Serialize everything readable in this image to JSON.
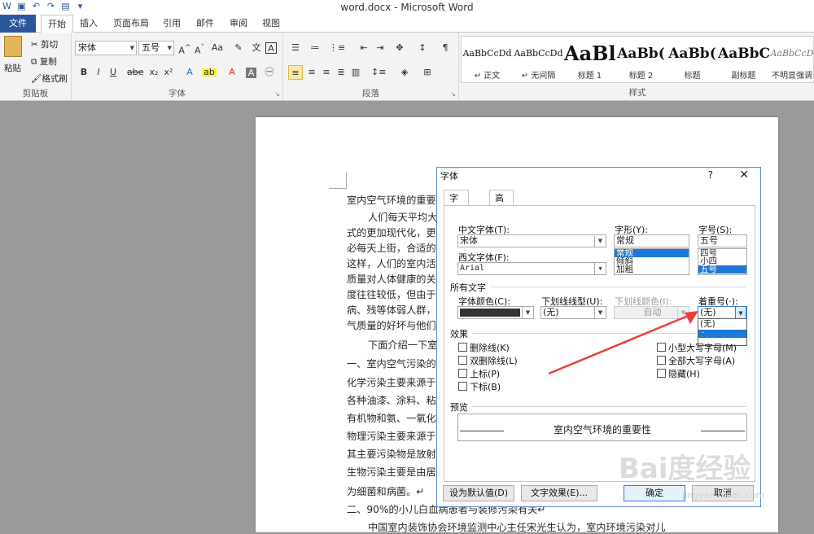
{
  "window": {
    "title": "word.docx - Microsoft Word"
  },
  "tabs": [
    "文件",
    "开始",
    "插入",
    "页面布局",
    "引用",
    "邮件",
    "审阅",
    "视图"
  ],
  "clipboard": {
    "paste": "粘贴",
    "cut": "剪切",
    "copy": "复制",
    "format_painter": "格式刷",
    "label": "剪贴板"
  },
  "font_group": {
    "font": "宋体",
    "size": "五号",
    "label": "字体"
  },
  "paragraph_group": {
    "label": "段落"
  },
  "styles_group": {
    "label": "样式",
    "items": [
      {
        "sample": "AaBbCcDd",
        "name": "↵ 正文"
      },
      {
        "sample": "AaBbCcDd",
        "name": "↵ 无间隔"
      },
      {
        "sample": "AaBl",
        "name": "标题 1"
      },
      {
        "sample": "AaBb(",
        "name": "标题 2"
      },
      {
        "sample": "AaBb(",
        "name": "标题"
      },
      {
        "sample": "AaBbC",
        "name": "副标题"
      },
      {
        "sample": "AaBbCcD",
        "name": "不明显强调"
      }
    ]
  },
  "document": {
    "lines": [
      "室内空气环境的重要",
      "人们每天平均大",
      "式的更加现代化，更",
      "必每天上街，合适的",
      "这样，人们的室内活",
      "质量对人体健康的关",
      "度往往较低，但由于",
      "病、残等体弱人群，",
      "气质量的好坏与他们",
      "下面介绍一下室",
      "一、室内空气污染的",
      "化学污染主要来源于",
      "各种油漆、涂料、粘",
      "有机物和氨、一氧化",
      "物理污染主要来源于",
      "其主要污染物是放射",
      "生物污染主要是由居",
      "为细菌和病菌。↵",
      "二、90%的小儿白血病患者与装修污染有关↵",
      "中国室内装饰协会环境监测中心主任宋光生认为，室内环境污染对儿"
    ]
  },
  "dialog": {
    "title": "字体",
    "help": "?",
    "close": "✕",
    "tabs": [
      "字体(N)",
      "高级(V)"
    ],
    "cn_font_label": "中文字体(T):",
    "cn_font_value": "宋体",
    "west_font_label": "西文字体(F):",
    "west_font_value": "Arial",
    "style_label": "字形(Y):",
    "style_value": "常规",
    "style_options": [
      "常规",
      "倾斜",
      "加粗"
    ],
    "size_label": "字号(S):",
    "size_value": "五号",
    "size_options": [
      "四号",
      "小四",
      "五号"
    ],
    "all_text": "所有文字",
    "font_color_label": "字体颜色(C):",
    "underline_label": "下划线线型(U):",
    "underline_value": "(无)",
    "underline_color_label": "下划线颜色(I):",
    "underline_color_value": "自动",
    "emphasis_label": "着重号(·):",
    "emphasis_value": "(无)",
    "emphasis_options": [
      "(无)",
      "·"
    ],
    "effects": "效果",
    "effects_left": [
      "删除线(K)",
      "双删除线(L)",
      "上标(P)",
      "下标(B)"
    ],
    "effects_right": [
      "小型大写字母(M)",
      "全部大写字母(A)",
      "隐藏(H)"
    ],
    "preview_label": "预览",
    "preview_text": "室内空气环境的重要性",
    "btn_default": "设为默认值(D)",
    "btn_effects": "文字效果(E)...",
    "btn_ok": "确定",
    "btn_cancel": "取消"
  },
  "watermark": {
    "text": "Bai度经验",
    "url": "jingyan.baidu.com"
  },
  "colors": {
    "accent": "#2b579a",
    "selection": "#1e78d7",
    "arrow": "#e8413a"
  }
}
